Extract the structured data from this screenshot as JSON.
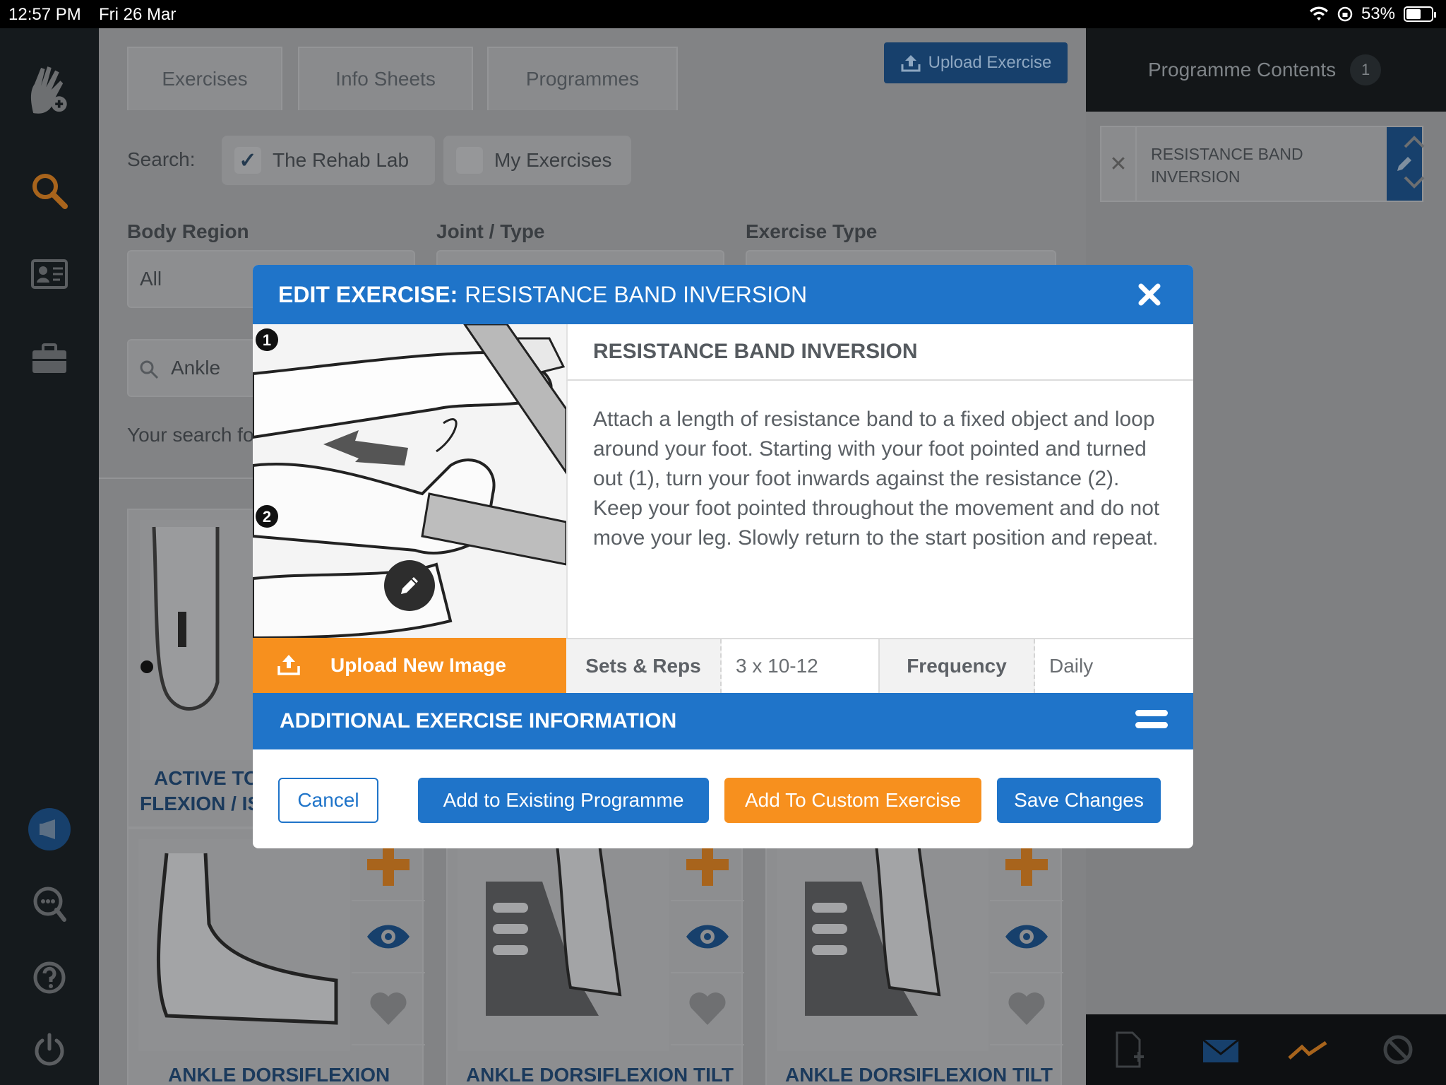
{
  "status_bar": {
    "time": "12:57 PM",
    "date": "Fri 26 Mar",
    "battery": "53%"
  },
  "tabs": [
    {
      "label": "Exercises"
    },
    {
      "label": "Info Sheets"
    },
    {
      "label": "Programmes"
    }
  ],
  "upload_exercise_label": "Upload Exercise",
  "search": {
    "label": "Search:",
    "option_rehab_lab": "The Rehab Lab",
    "option_my_exercises": "My Exercises",
    "query": "Ankle",
    "results_text": "Your search fo"
  },
  "filters": {
    "body_region_label": "Body Region",
    "body_region_value": "All",
    "joint_type_label": "Joint / Type",
    "exercise_type_label": "Exercise Type"
  },
  "cards": [
    {
      "title_line1": "ACTIVE TO",
      "title_line2": "FLEXION / IS"
    },
    {
      "title": "ANKLE DORSIFLEXION"
    },
    {
      "title": "ANKLE DORSIFLEXION TILT"
    },
    {
      "title": "ANKLE DORSIFLEXION TILT"
    }
  ],
  "programme_panel": {
    "title": "Programme Contents",
    "count": "1",
    "item_name": "RESISTANCE BAND INVERSION"
  },
  "modal": {
    "header_prefix": "EDIT EXERCISE:",
    "header_name": "RESISTANCE BAND INVERSION",
    "exercise_title": "RESISTANCE BAND INVERSION",
    "description": "Attach a length of resistance band to a fixed object and loop around your foot. Starting with your foot pointed and turned out (1), turn your foot inwards against the resistance (2). Keep your foot pointed throughout the movement and do not move your leg. Slowly return to the start position and repeat.",
    "upload_new_image": "Upload New Image",
    "sets_reps_label": "Sets & Reps",
    "sets_reps_value": "3 x 10-12",
    "frequency_label": "Frequency",
    "frequency_value": "Daily",
    "additional_info": "ADDITIONAL EXERCISE INFORMATION",
    "buttons": {
      "cancel": "Cancel",
      "add_existing": "Add to Existing Programme",
      "add_custom": "Add To Custom Exercise",
      "save": "Save Changes"
    },
    "step_labels": [
      "1",
      "2"
    ]
  },
  "colors": {
    "primary_blue": "#1f74c9",
    "orange": "#f7901e",
    "nav_dark": "#151a1d"
  }
}
